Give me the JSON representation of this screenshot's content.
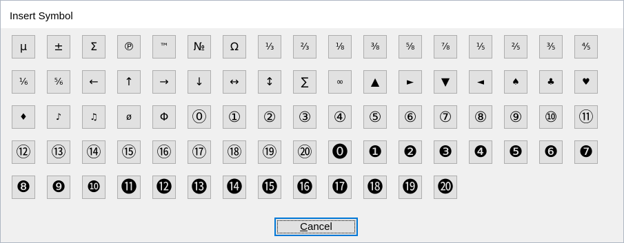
{
  "window": {
    "title": "Insert Symbol"
  },
  "symbols": [
    "µ",
    "±",
    "Σ",
    "℗",
    "™",
    "№",
    "Ω",
    "⅓",
    "⅔",
    "⅛",
    "⅜",
    "⅝",
    "⅞",
    "⅕",
    "⅖",
    "⅗",
    "⅘",
    "⅙",
    "⅚",
    "←",
    "↑",
    "→",
    "↓",
    "↔",
    "↕",
    "∑",
    "∞",
    "▲",
    "►",
    "▼",
    "◄",
    "♠",
    "♣",
    "♥",
    "♦",
    "♪",
    "♫",
    "ø",
    "Φ",
    "⓪",
    "①",
    "②",
    "③",
    "④",
    "⑤",
    "⑥",
    "⑦",
    "⑧",
    "⑨",
    "⑩",
    "⑪",
    "⑫",
    "⑬",
    "⑭",
    "⑮",
    "⑯",
    "⑰",
    "⑱",
    "⑲",
    "⑳",
    "⓿",
    "❶",
    "❷",
    "❸",
    "❹",
    "❺",
    "❻",
    "❼",
    "❽",
    "❾",
    "❿",
    "⓫",
    "⓬",
    "⓭",
    "⓮",
    "⓯",
    "⓰",
    "⓱",
    "⓲",
    "⓳",
    "⓴"
  ],
  "cancel_button": {
    "label": "Cancel",
    "mnemonic": "C",
    "label_rest": "ancel"
  },
  "colors": {
    "button_face": "#e1e1e1",
    "button_border": "#adadad",
    "dialog_background": "#f0f0f0",
    "focus_border": "#0078d7"
  }
}
